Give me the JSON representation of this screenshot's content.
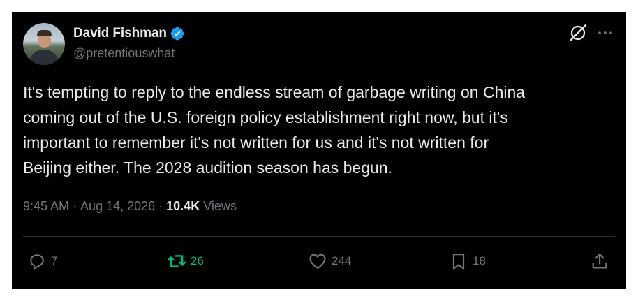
{
  "author": {
    "name": "David Fishman",
    "handle": "@pretentiouswhat",
    "verified": true
  },
  "tweet": {
    "text": "It's tempting to reply to the endless stream of garbage writing on China\ncoming out of the U.S. foreign policy establishment right now, but it's\nimportant to remember it's not written for us and it's not written for\nBeijing either. The 2028 audition season has begun.",
    "time": "9:45 AM",
    "date": "Aug 14, 2026",
    "separator": " · ",
    "views_count": "10.4K",
    "views_label": " Views"
  },
  "actions": {
    "reply_count": "7",
    "retweet_count": "26",
    "like_count": "244",
    "bookmark_count": "18"
  },
  "icons": {
    "verified": "verified-badge-icon",
    "grok": "grok-icon",
    "more": "more-icon",
    "reply": "reply-icon",
    "retweet": "retweet-icon",
    "like": "heart-icon",
    "bookmark": "bookmark-icon",
    "share": "share-icon"
  },
  "colors": {
    "background": "#000000",
    "text": "#e7e9ea",
    "muted": "#71767b",
    "verified": "#1d9bf0",
    "retweet_active": "#00ba7c",
    "divider": "#2f3336"
  }
}
